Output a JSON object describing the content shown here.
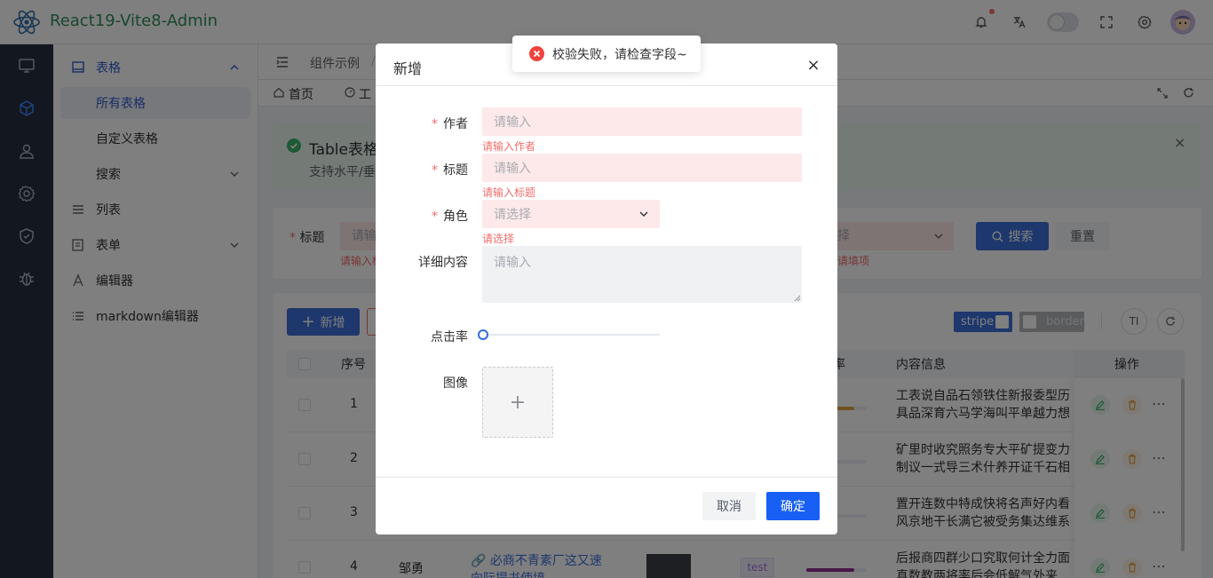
{
  "app": {
    "title": "React19-Vite8-Admin"
  },
  "colors": {
    "primary": "#1860f5",
    "error": "#f56c6c",
    "success": "#3cb36b",
    "rail": "#262f3e",
    "brand": "#2f8f5b"
  },
  "header": {
    "icons": [
      "bell-icon",
      "translate-icon",
      "theme-toggle",
      "fullscreen-icon",
      "settings-icon",
      "avatar"
    ]
  },
  "rail": {
    "icons": [
      "monitor-icon",
      "cube-icon",
      "user-icon",
      "settings-icon",
      "shield-icon",
      "bug-icon"
    ]
  },
  "menu": {
    "group_table": "表格",
    "all_tables": "所有表格",
    "custom_table": "自定义表格",
    "search": "搜索",
    "list": "列表",
    "form": "表单",
    "editor": "编辑器",
    "markdown_editor": "markdown编辑器"
  },
  "breadcrumb": {
    "item1": "组件示例",
    "sep": "/"
  },
  "tabs": {
    "home": "首页",
    "work": "工"
  },
  "alert": {
    "title": "Table表格",
    "desc": "支持水平/垂"
  },
  "search": {
    "title_label": "标题",
    "title_placeholder": "请输",
    "title_error": "请输入标",
    "select_placeholder": "择",
    "select_error": "请填项",
    "search_button": "搜索",
    "reset_button": "重置"
  },
  "toolbar": {
    "add_button": "新增",
    "stripe": "stripe",
    "border": "border"
  },
  "table": {
    "headers": {
      "index": "序号",
      "rate": "率",
      "content": "内容信息",
      "actions": "操作"
    },
    "rows": [
      {
        "index": "1",
        "content_line1": "工表说自品石领铁住新报委型历",
        "content_line2": "具品深育六马学海叫平单越力想"
      },
      {
        "index": "2",
        "content_line1": "矿里时收究照务专大平矿提变力",
        "content_line2": "制议一式导三术什养开证千石相"
      },
      {
        "index": "3",
        "content_line1": "置开连数中特成快将名声好内看",
        "content_line2": "风京地干长满它被受务集达维系"
      },
      {
        "index": "4",
        "author": "邹勇",
        "link": "必商不青素厂这又速",
        "link2": "向际提书使境",
        "tag": "test",
        "content_line1": "后报商四群少口究取何计全力面",
        "content_line2": "真数教两将率后会低解气外来"
      }
    ]
  },
  "dialog": {
    "title": "新增",
    "close": "×",
    "author_label": "作者",
    "author_placeholder": "请输入",
    "author_error": "请输入作者",
    "title_label": "标题",
    "title_placeholder": "请输入",
    "title_error": "请输入标题",
    "role_label": "角色",
    "role_placeholder": "请选择",
    "role_error": "请选择",
    "detail_label": "详细内容",
    "detail_placeholder": "请输入",
    "rate_label": "点击率",
    "rate_value": 0,
    "image_label": "图像",
    "upload_plus": "+",
    "cancel": "取消",
    "confirm": "确定"
  },
  "toast": {
    "message": "校验失败，请检查字段~"
  }
}
